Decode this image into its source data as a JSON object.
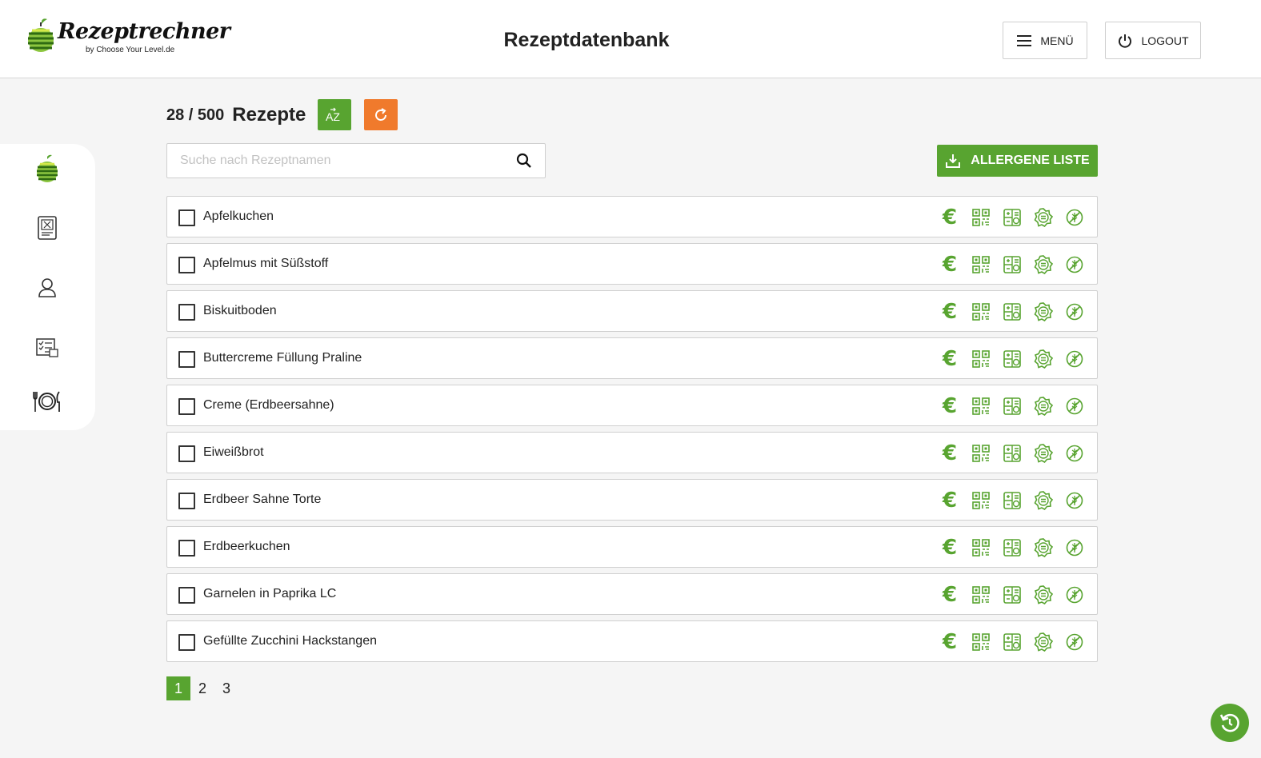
{
  "header": {
    "logo_text": "Rezeptrechner",
    "logo_subtext": "by Choose Your Level.de",
    "title": "Rezeptdatenbank",
    "menu_label": "MENÜ",
    "logout_label": "LOGOUT"
  },
  "sidebar": {
    "items": [
      {
        "icon": "apple-logo-icon"
      },
      {
        "icon": "recipe-tablet-icon"
      },
      {
        "icon": "user-icon"
      },
      {
        "icon": "checklist-icon"
      },
      {
        "icon": "plate-cutlery-icon"
      }
    ]
  },
  "summary": {
    "count": "28 / 500",
    "label": "Rezepte",
    "sort_icon": "sort-az-icon",
    "refresh_icon": "refresh-icon"
  },
  "search": {
    "placeholder": "Suche nach Rezeptnamen",
    "value": ""
  },
  "allergen_button": {
    "label": "ALLERGENE LISTE",
    "icon": "download-icon"
  },
  "recipes": [
    {
      "name": "Apfelkuchen",
      "checked": false
    },
    {
      "name": "Apfelmus mit Süßstoff",
      "checked": false
    },
    {
      "name": "Biskuitboden",
      "checked": false
    },
    {
      "name": "Buttercreme Füllung Praline",
      "checked": false
    },
    {
      "name": "Creme (Erdbeersahne)",
      "checked": false
    },
    {
      "name": "Eiweißbrot",
      "checked": false
    },
    {
      "name": "Erdbeer Sahne Torte",
      "checked": false
    },
    {
      "name": "Erdbeerkuchen",
      "checked": false
    },
    {
      "name": "Garnelen in Paprika LC",
      "checked": false
    },
    {
      "name": "Gefüllte Zucchini Hackstangen",
      "checked": false
    }
  ],
  "row_actions": {
    "price_symbol": "€",
    "icons": [
      "euro-icon",
      "qr-code-icon",
      "nutrition-table-icon",
      "badge-icon",
      "no-gluten-icon"
    ]
  },
  "pagination": {
    "pages": [
      "1",
      "2",
      "3"
    ],
    "current": "1"
  },
  "colors": {
    "accent_green": "#58a430",
    "accent_orange": "#f07a2c",
    "background": "#f5f5f5"
  }
}
